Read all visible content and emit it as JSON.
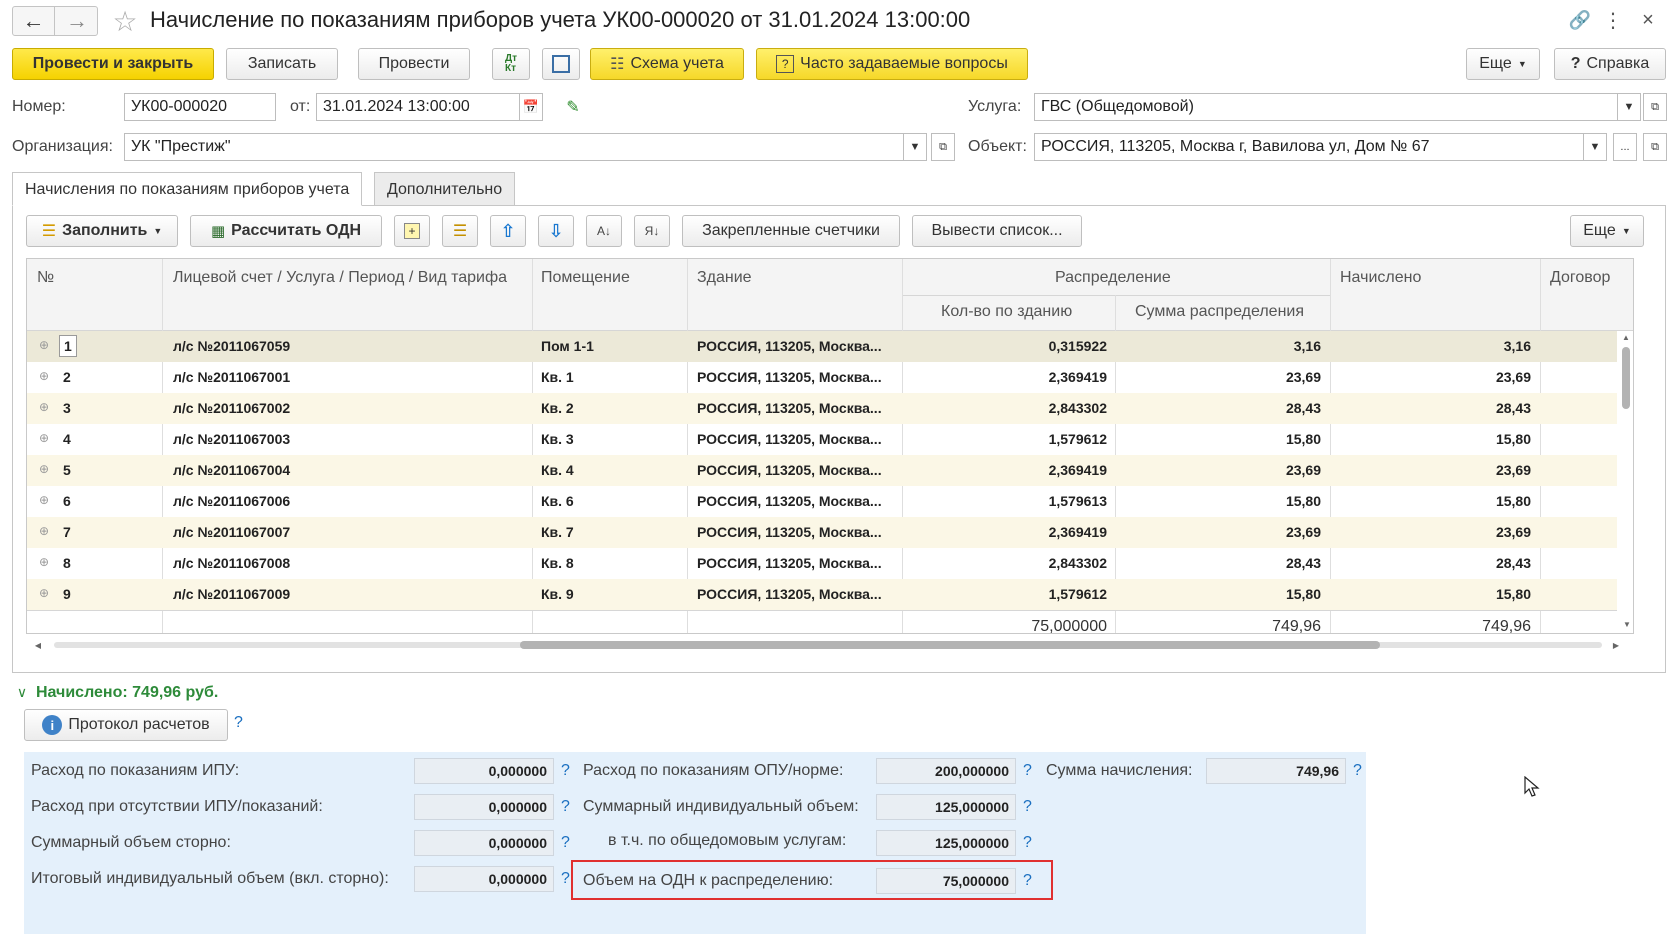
{
  "window": {
    "title": "Начисление по показаниям приборов учета УК00-000020 от 31.01.2024 13:00:00"
  },
  "toolbar": {
    "post_close": "Провести и закрыть",
    "save": "Записать",
    "post": "Провести",
    "scheme": "Схема учета",
    "faq": "Часто задаваемые вопросы",
    "more": "Еще",
    "help": "Справка"
  },
  "header": {
    "number_label": "Номер:",
    "number_value": "УК00-000020",
    "date_label": "от:",
    "date_value": "31.01.2024 13:00:00",
    "org_label": "Организация:",
    "org_value": "УК \"Престиж\"",
    "service_label": "Услуга:",
    "service_value": "ГВС (Общедомовой)",
    "object_label": "Объект:",
    "object_value": "РОССИЯ, 113205, Москва г, Вавилова ул, Дом № 67"
  },
  "tabs": [
    {
      "label": "Начисления по показаниям приборов учета",
      "active": true
    },
    {
      "label": "Дополнительно",
      "active": false
    }
  ],
  "grid_toolbar": {
    "fill": "Заполнить",
    "calc": "Рассчитать ОДН",
    "pinned": "Закрепленные счетчики",
    "list": "Вывести список...",
    "more": "Еще"
  },
  "grid": {
    "columns": {
      "num": "№",
      "account": "Лицевой счет / Услуга / Период / Вид тарифа",
      "room": "Помещение",
      "building": "Здание",
      "distribution": "Распределение",
      "qty": "Кол-во по зданию",
      "sum": "Сумма распределения",
      "charged": "Начислено",
      "contract": "Договор"
    },
    "rows": [
      {
        "n": "1",
        "account": "л/с №2011067059",
        "room": "Пом 1-1",
        "building": "РОССИЯ, 113205, Москва...",
        "qty": "0,315922",
        "sum": "3,16",
        "charged": "3,16"
      },
      {
        "n": "2",
        "account": "л/с №2011067001",
        "room": "Кв. 1",
        "building": "РОССИЯ, 113205, Москва...",
        "qty": "2,369419",
        "sum": "23,69",
        "charged": "23,69"
      },
      {
        "n": "3",
        "account": "л/с №2011067002",
        "room": "Кв. 2",
        "building": "РОССИЯ, 113205, Москва...",
        "qty": "2,843302",
        "sum": "28,43",
        "charged": "28,43"
      },
      {
        "n": "4",
        "account": "л/с №2011067003",
        "room": "Кв. 3",
        "building": "РОССИЯ, 113205, Москва...",
        "qty": "1,579612",
        "sum": "15,80",
        "charged": "15,80"
      },
      {
        "n": "5",
        "account": "л/с №2011067004",
        "room": "Кв. 4",
        "building": "РОССИЯ, 113205, Москва...",
        "qty": "2,369419",
        "sum": "23,69",
        "charged": "23,69"
      },
      {
        "n": "6",
        "account": "л/с №2011067006",
        "room": "Кв. 6",
        "building": "РОССИЯ, 113205, Москва...",
        "qty": "1,579613",
        "sum": "15,80",
        "charged": "15,80"
      },
      {
        "n": "7",
        "account": "л/с №2011067007",
        "room": "Кв. 7",
        "building": "РОССИЯ, 113205, Москва...",
        "qty": "2,369419",
        "sum": "23,69",
        "charged": "23,69"
      },
      {
        "n": "8",
        "account": "л/с №2011067008",
        "room": "Кв. 8",
        "building": "РОССИЯ, 113205, Москва...",
        "qty": "2,843302",
        "sum": "28,43",
        "charged": "28,43"
      },
      {
        "n": "9",
        "account": "л/с №2011067009",
        "room": "Кв. 9",
        "building": "РОССИЯ, 113205, Москва...",
        "qty": "1,579612",
        "sum": "15,80",
        "charged": "15,80"
      }
    ],
    "totals": {
      "qty": "75,000000",
      "sum": "749,96",
      "charged": "749,96"
    }
  },
  "summary": {
    "charged": "Начислено: 749,96 руб.",
    "protocol": "Протокол расчетов",
    "help_mark": "?"
  },
  "params": {
    "ipu_label": "Расход по показаниям ИПУ:",
    "ipu_value": "0,000000",
    "no_ipu_label": "Расход при отсутствии ИПУ/показаний:",
    "no_ipu_value": "0,000000",
    "storno_label": "Суммарный объем сторно:",
    "storno_value": "0,000000",
    "total_ind_label": "Итоговый индивидуальный объем (вкл. сторно):",
    "total_ind_value": "0,000000",
    "opu_label": "Расход по показаниям ОПУ/норме:",
    "opu_value": "200,000000",
    "sum_ind_label": "Суммарный индивидуальный объем:",
    "sum_ind_value": "125,000000",
    "incl_common_label": "в т.ч. по общедомовым услугам:",
    "incl_common_value": "125,000000",
    "odn_label": "Объем на ОДН к распределению:",
    "odn_value": "75,000000",
    "charge_sum_label": "Сумма начисления:",
    "charge_sum_value": "749,96"
  },
  "colors": {
    "accent_yellow": "#f5d200",
    "summary_green": "#2e8b3a",
    "params_bg": "#e4f0fb",
    "highlight_red": "#e03030",
    "link_blue": "#1a6fc0"
  }
}
